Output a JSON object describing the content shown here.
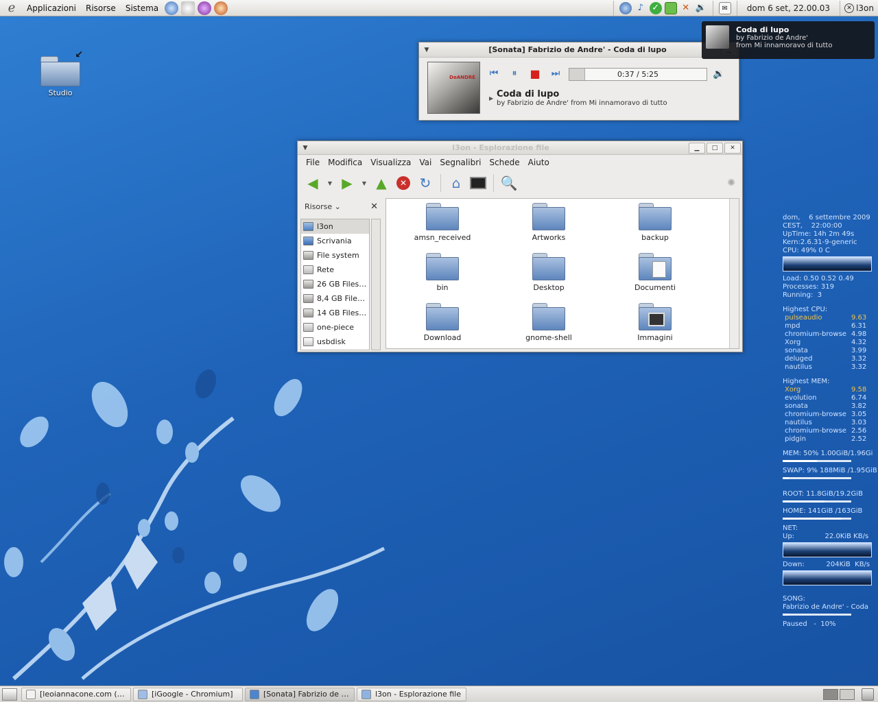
{
  "top_panel": {
    "menus": [
      "Applicazioni",
      "Risorse",
      "Sistema"
    ],
    "clock": "dom  6 set, 22.00.03",
    "user": "l3on"
  },
  "desktop": {
    "icon_label": "Studio"
  },
  "notification": {
    "title": "Coda di lupo",
    "line1": "by Fabrizio de Andre'",
    "line2": "from Mi innamoravo di tutto"
  },
  "sonata": {
    "title": "[Sonata] Fabrizio de Andre' - Coda di lupo",
    "progress_text": "0:37 / 5:25",
    "progress_fraction": 0.114,
    "song_title": "Coda di lupo",
    "song_sub": "by Fabrizio de Andre' from Mi innamoravo di tutto",
    "art_badge": "DeANDRÉ"
  },
  "nautilus": {
    "title": "l3on - Esplorazione file",
    "menu": [
      "File",
      "Modifica",
      "Visualizza",
      "Vai",
      "Segnalibri",
      "Schede",
      "Aiuto"
    ],
    "sidebar_label": "Risorse",
    "places": [
      {
        "label": "l3on",
        "icon": "home"
      },
      {
        "label": "Scrivania",
        "icon": "desk"
      },
      {
        "label": "File system",
        "icon": "disk"
      },
      {
        "label": "Rete",
        "icon": "net"
      },
      {
        "label": "26 GB Files…",
        "icon": "disk"
      },
      {
        "label": "8,4 GB File…",
        "icon": "disk"
      },
      {
        "label": "14 GB Files…",
        "icon": "disk"
      },
      {
        "label": "one-piece",
        "icon": "net"
      },
      {
        "label": "usbdisk",
        "icon": "usb"
      }
    ],
    "files": [
      {
        "label": "amsn_received",
        "kind": "folder"
      },
      {
        "label": "Artworks",
        "kind": "folder"
      },
      {
        "label": "backup",
        "kind": "folder"
      },
      {
        "label": "bin",
        "kind": "folder"
      },
      {
        "label": "Desktop",
        "kind": "folder"
      },
      {
        "label": "Documenti",
        "kind": "doc"
      },
      {
        "label": "Download",
        "kind": "folder"
      },
      {
        "label": "gnome-shell",
        "kind": "folder"
      },
      {
        "label": "Immagini",
        "kind": "pic"
      }
    ]
  },
  "conky": {
    "date_label": "dom,",
    "date": "6 settembre 2009",
    "tz_label": "CEST,",
    "time": "22:00:00",
    "uptime_label": "UpTime:",
    "uptime": "14h 2m 49s",
    "kern_label": "Kern:",
    "kern": "2.6.31-9-generic",
    "cpu_label": "CPU:",
    "cpu": "49% 0  C",
    "load_label": "Load:",
    "load": "0.50 0.52 0.49",
    "proc_label": "Processes:",
    "proc": "319",
    "run_label": "Running:",
    "run": "3",
    "high_cpu_label": "Highest CPU:",
    "high_cpu": [
      {
        "name": "pulseaudio",
        "val": "9.63"
      },
      {
        "name": "mpd",
        "val": "6.31"
      },
      {
        "name": "chromium-browse",
        "val": "4.98"
      },
      {
        "name": "Xorg",
        "val": "4.32"
      },
      {
        "name": "sonata",
        "val": "3.99"
      },
      {
        "name": "deluged",
        "val": "3.32"
      },
      {
        "name": "nautilus",
        "val": "3.32"
      }
    ],
    "high_mem_label": "Highest MEM:",
    "high_mem": [
      {
        "name": "Xorg",
        "val": "9.58"
      },
      {
        "name": "evolution",
        "val": "6.74"
      },
      {
        "name": "sonata",
        "val": "3.82"
      },
      {
        "name": "chromium-browse",
        "val": "3.05"
      },
      {
        "name": "nautilus",
        "val": "3.03"
      },
      {
        "name": "chromium-browse",
        "val": "2.56"
      },
      {
        "name": "pidgin",
        "val": "2.52"
      }
    ],
    "mem": "MEM:  50% 1.00GiB/1.96Gi",
    "mem_fraction": 0.5,
    "swap": "SWAP: 9% 188MiB /1.95GiB",
    "swap_fraction": 0.09,
    "root": "ROOT:  11.8GiB/19.2GiB",
    "root_fraction": 0.61,
    "home": "HOME:  141GiB /163GiB",
    "home_fraction": 0.86,
    "net_label": "NET:",
    "up": "Up:              22.0KiB KB/s",
    "down": "Down:          204KiB  KB/s",
    "song_label": "SONG:",
    "song": "Fabrizio de Andre' - Coda",
    "song_fraction": 0.1,
    "song_state": "Paused   -  10%"
  },
  "taskbar": [
    {
      "label": "[leoiannacone.com (…",
      "active": false
    },
    {
      "label": "[iGoogle - Chromium]",
      "active": false
    },
    {
      "label": "[Sonata] Fabrizio de …",
      "active": true
    },
    {
      "label": "l3on - Esplorazione file",
      "active": false
    }
  ]
}
